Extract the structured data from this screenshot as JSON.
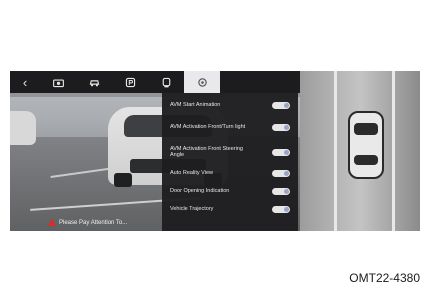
{
  "toolbar": {
    "items": [
      {
        "icon": "back-arrow-icon",
        "glyph": "‹"
      },
      {
        "icon": "camera-view-icon"
      },
      {
        "icon": "car-view-icon"
      },
      {
        "icon": "parking-icon"
      },
      {
        "icon": "rear-camera-icon"
      },
      {
        "icon": "settings-gear-icon",
        "active": true
      }
    ]
  },
  "camera": {
    "warning_text": "Please Pay Attention To..."
  },
  "menu": {
    "items": [
      {
        "label": "AVM Start Animation",
        "on": true
      },
      {
        "label": "AVM Activation Front/Turn light",
        "on": true
      },
      {
        "label": "AVM Activation Front Steering Angle",
        "on": true
      },
      {
        "label": "Auto Reality View",
        "on": true
      },
      {
        "label": "Door Opening Indication",
        "on": true
      },
      {
        "label": "Vehicle Trajectory",
        "on": true
      }
    ]
  },
  "caption": "OMT22-4380",
  "colors": {
    "menu_bg": "#1e1e20",
    "toggle_track": "#e6e6e6",
    "toggle_knob": "#9aa4c8",
    "warning": "#e02a2a"
  }
}
